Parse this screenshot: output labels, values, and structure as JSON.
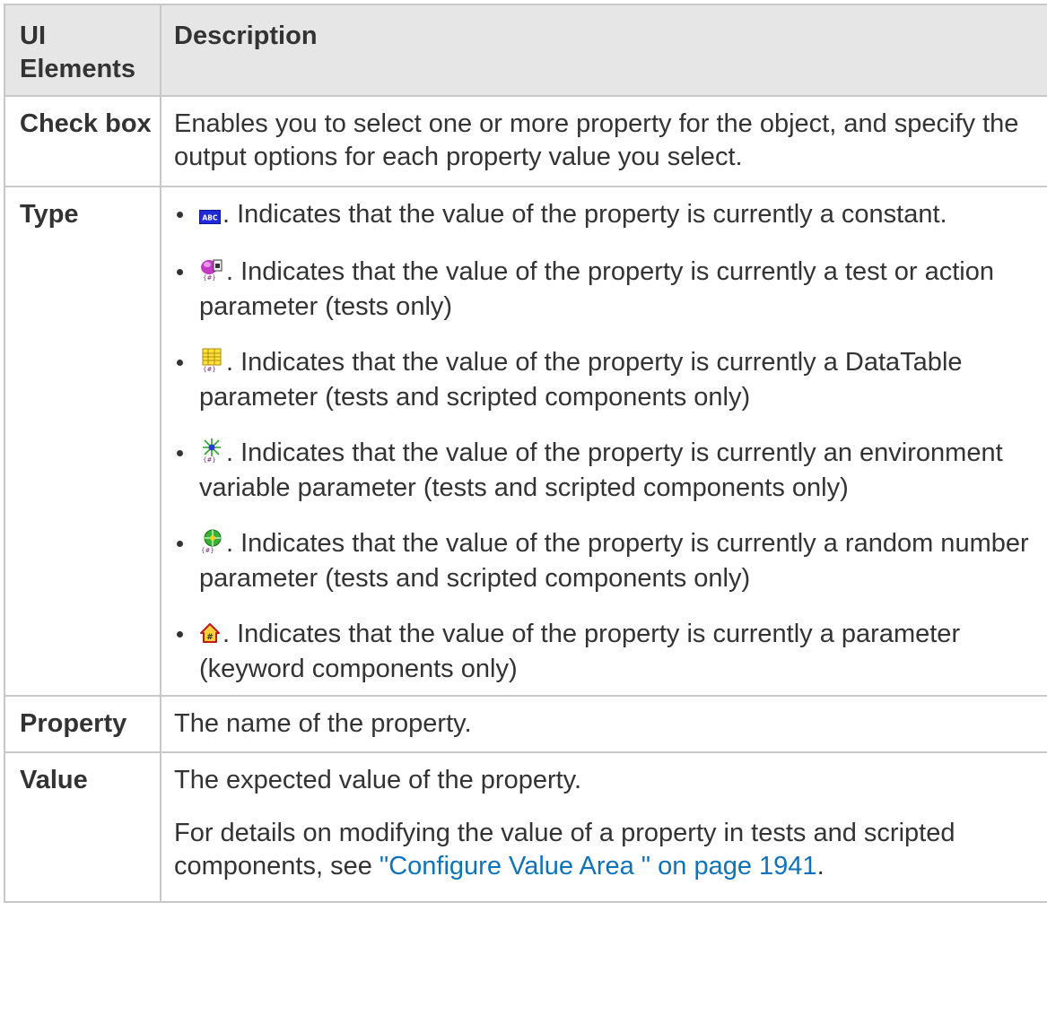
{
  "headers": {
    "col1": "UI Elements",
    "col2": "Description"
  },
  "rows": {
    "checkbox": {
      "name": "Check box",
      "description": "Enables you to select one or more property for the object, and specify the output options for each property value you select."
    },
    "type": {
      "name": "Type",
      "items": [
        {
          "icon": "constant-icon",
          "text": ". Indicates that the value of the property is currently a constant."
        },
        {
          "icon": "test-action-parameter-icon",
          "text": ". Indicates that the value of the property is currently a test or action parameter (tests only)"
        },
        {
          "icon": "datatable-parameter-icon",
          "text": ". Indicates that the value of the property is currently a DataTable parameter (tests and scripted components only)"
        },
        {
          "icon": "environment-variable-icon",
          "text": ". Indicates that the value of the property is currently an environment variable parameter (tests and scripted components only)"
        },
        {
          "icon": "random-number-parameter-icon",
          "text": ". Indicates that the value of the property is currently a random number parameter (tests and scripted components only)"
        },
        {
          "icon": "keyword-parameter-icon",
          "text": ". Indicates that the value of the property is currently a parameter (keyword components only)"
        }
      ]
    },
    "property": {
      "name": "Property",
      "description": "The name of the property."
    },
    "value": {
      "name": "Value",
      "description": "The expected value of the property.",
      "details_prefix": "For details on modifying the value of a property in tests and scripted components, see ",
      "details_link": "\"Configure Value Area \" on page 1941",
      "details_suffix": "."
    }
  },
  "colors": {
    "text": "#333333",
    "header_bg": "#e6e6e6",
    "border": "#c8c8c8",
    "link": "#0f73b9"
  }
}
